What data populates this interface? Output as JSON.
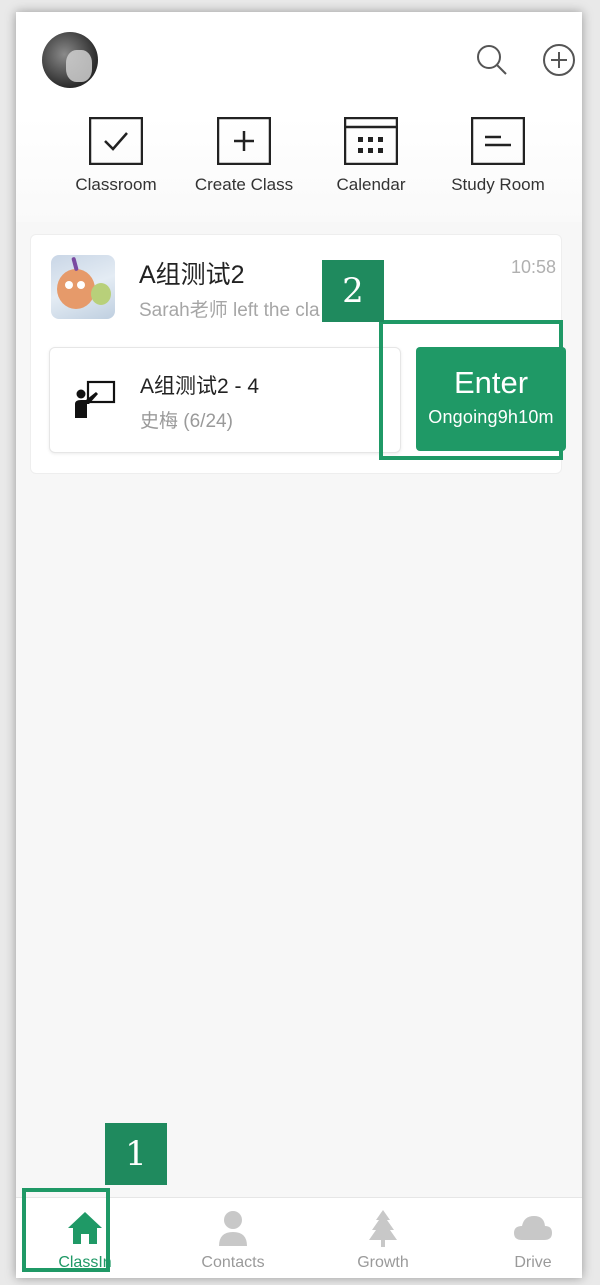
{
  "quick_actions": [
    {
      "label": "Classroom",
      "icon": "checkbox-icon"
    },
    {
      "label": "Create Class",
      "icon": "plus-box-icon"
    },
    {
      "label": "Calendar",
      "icon": "calendar-icon"
    },
    {
      "label": "Study Room",
      "icon": "study-room-icon"
    }
  ],
  "group": {
    "title": "A组测试2",
    "subtitle": "Sarah老师 left the cla",
    "time": "10:58"
  },
  "lesson": {
    "title": "A组测试2 - 4",
    "subtitle": "史梅 (6/24)",
    "enter_label": "Enter",
    "status": "Ongoing9h10m"
  },
  "tabs": [
    {
      "label": "ClassIn",
      "icon": "home-icon",
      "active": true
    },
    {
      "label": "Contacts",
      "icon": "person-icon",
      "active": false
    },
    {
      "label": "Growth",
      "icon": "tree-icon",
      "active": false
    },
    {
      "label": "Drive",
      "icon": "cloud-icon",
      "active": false
    }
  ],
  "annotations": {
    "step1": "1",
    "step2": "2"
  },
  "colors": {
    "accent": "#1f9966",
    "inactive": "#c8c8c8"
  }
}
